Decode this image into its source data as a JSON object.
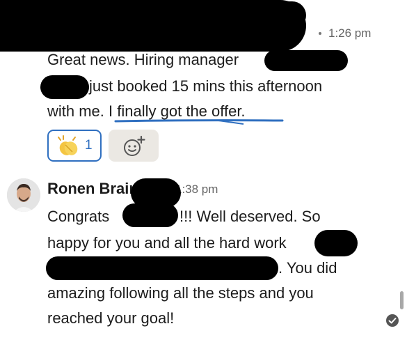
{
  "message1": {
    "timestamp": "1:26 pm",
    "lines": [
      "Great news. Hiring manager",
      "just booked 15 mins this afternoon",
      "with me.",
      "I finally got the offer."
    ],
    "reaction": {
      "emoji": "clapping-hands-emoji",
      "count": "1"
    },
    "add_reaction_icon": "add-emoji-icon"
  },
  "message2": {
    "sender": "Ronen Brainin",
    "timestamp": "1:38 pm",
    "lines": [
      "Congrats",
      "!!! Well deserved. So",
      "happy for you and all the hard work",
      ". You did",
      "amazing following all the steps and you",
      "reached your goal!"
    ]
  },
  "status_icon": "seen-check-icon",
  "colors": {
    "accent": "#2f6fc0",
    "text": "#1c1c1c",
    "muted": "#666666",
    "add_reaction_bg": "#ebe8e3"
  }
}
